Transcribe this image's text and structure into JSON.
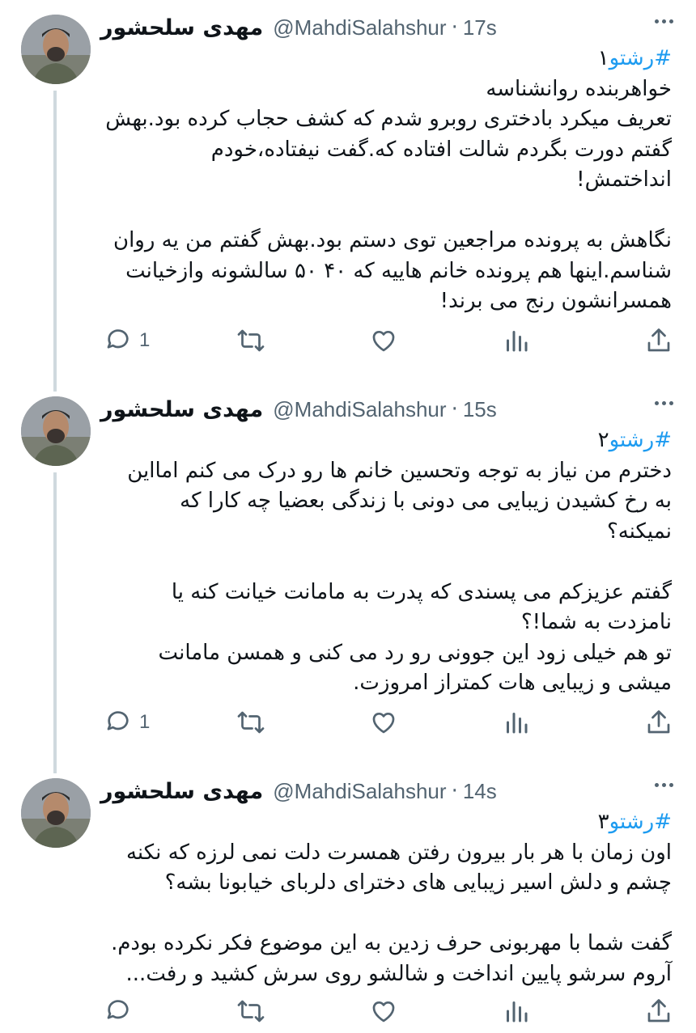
{
  "tweets": [
    {
      "name": "مهدی سلحشور",
      "handle": "@MahdiSalahshur",
      "time": "17s",
      "hashtag": "#رشتو",
      "number": "۱",
      "lines": [
        "خواهربنده روانشناسه",
        "تعریف میکرد بادختری روبرو شدم که کشف حجاب کرده بود.بهش",
        "گفتم دورت بگردم شالت افتاده که.گفت نیفتاده،خودم",
        "انداختمش!",
        "",
        "نگاهش به پرونده مراجعین توی دستم بود.بهش گفتم من یه روان",
        "شناسم.اینها هم پرونده خانم هاییه که ۴۰ ۵۰ سالشونه وازخیانت",
        "همسرانشون رنج می برند!"
      ],
      "reply_count": "1"
    },
    {
      "name": "مهدی سلحشور",
      "handle": "@MahdiSalahshur",
      "time": "15s",
      "hashtag": "#رشتو",
      "number": "۲",
      "lines": [
        "دخترم من نیاز به توجه وتحسین خانم ها رو درک می کنم امااین",
        "به رخ کشیدن زیبایی می دونی با زندگی بعضیا چه کارا که",
        "نمیکنه؟",
        "",
        "گفتم عزیزکم می پسندی که پدرت به مامانت خیانت کنه یا",
        "نامزدت به شما!؟",
        "تو هم خیلی زود این جوونی رو رد می کنی و همسن مامانت",
        "میشی و زیبایی هات کمتراز امروزت."
      ],
      "reply_count": "1"
    },
    {
      "name": "مهدی سلحشور",
      "handle": "@MahdiSalahshur",
      "time": "14s",
      "hashtag": "#رشتو",
      "number": "۳",
      "lines": [
        "اون زمان با هر بار بیرون رفتن همسرت دلت نمی لرزه که نکنه",
        "چشم و دلش اسیر زیبایی های دخترای دلربای خیابونا بشه؟",
        "",
        "گفت شما با مهربونی حرف زدین به این موضوع فکر نکرده بودم.",
        "آروم سرشو پایین انداخت و شالشو روی سرش کشید و رفت..."
      ],
      "reply_count": ""
    }
  ],
  "separator": "·",
  "icons": [
    "reply-icon",
    "retweet-icon",
    "like-icon",
    "views-icon",
    "share-icon",
    "more-icon"
  ],
  "colors": {
    "text": "#0f1419",
    "secondary": "#536471",
    "hashtag": "#1d9bf0",
    "thread_line": "#cfd9de"
  }
}
